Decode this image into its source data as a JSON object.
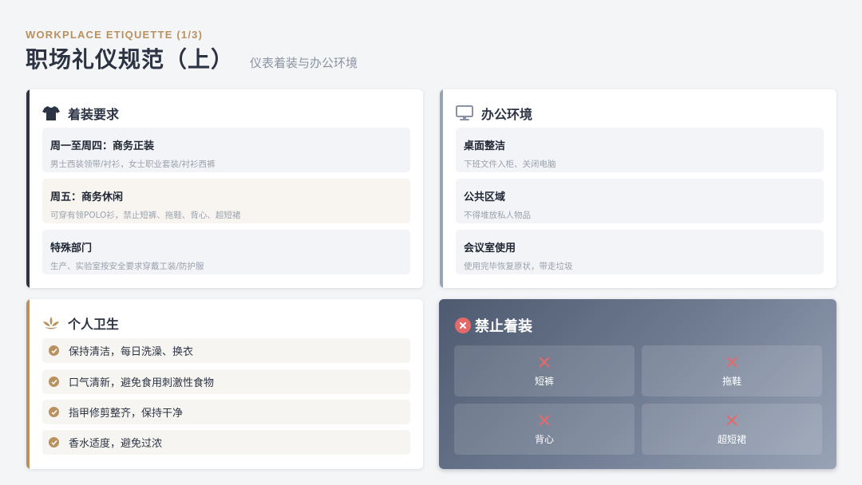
{
  "header": {
    "eyebrow": "WORKPLACE ETIQUETTE (1/3)",
    "title": "职场礼仪规范（上）",
    "subtitle": "仪表着装与办公环境"
  },
  "colors": {
    "accent_gold": "#b9915e",
    "accent_navy": "#2c3444",
    "accent_gray": "#9aa4b4",
    "forbid_red": "#e46a6a"
  },
  "dress": {
    "icon": "shirt-icon",
    "title": "着装要求",
    "items": [
      {
        "title": "周一至周四：商务正装",
        "desc": "男士西装领带/衬衫，女士职业套装/衬衫西裤"
      },
      {
        "title": "周五：商务休闲",
        "desc": "可穿有领POLO衫，禁止短裤、拖鞋、背心、超短裙"
      },
      {
        "title": "特殊部门",
        "desc": "生产、实验室按安全要求穿戴工装/防护服"
      }
    ]
  },
  "office": {
    "icon": "monitor-icon",
    "title": "办公环境",
    "items": [
      {
        "title": "桌面整洁",
        "desc": "下班文件入柜、关闭电脑"
      },
      {
        "title": "公共区域",
        "desc": "不得堆放私人物品"
      },
      {
        "title": "会议室使用",
        "desc": "使用完毕恢复原状，带走垃圾"
      }
    ]
  },
  "hygiene": {
    "icon": "lotus-icon",
    "title": "个人卫生",
    "items": [
      "保持清洁，每日洗澡、换衣",
      "口气清新，避免食用刺激性食物",
      "指甲修剪整齐，保持干净",
      "香水适度，避免过浓"
    ]
  },
  "forbidden": {
    "icon": "x-circle-icon",
    "title": "禁止着装",
    "items": [
      "短裤",
      "拖鞋",
      "背心",
      "超短裙"
    ]
  }
}
